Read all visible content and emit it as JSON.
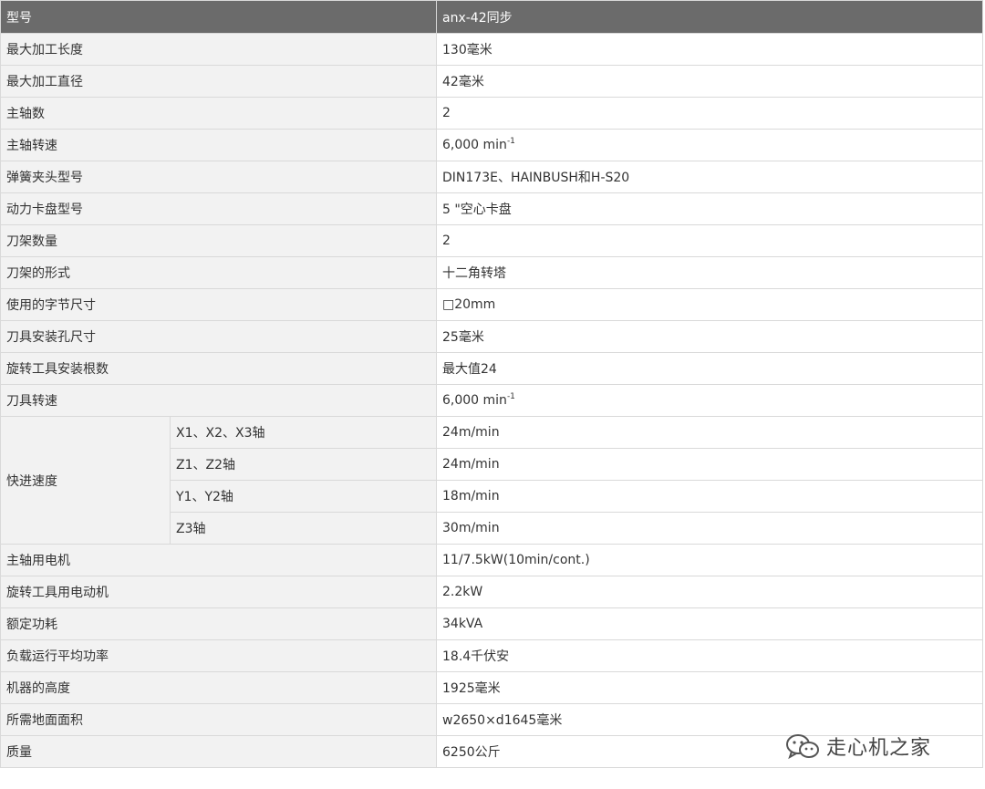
{
  "header": {
    "label": "型号",
    "model": "anx-42同步"
  },
  "rows_top": [
    {
      "label": "最大加工长度",
      "value": "130毫米"
    },
    {
      "label": "最大加工直径",
      "value": "42毫米"
    },
    {
      "label": "主轴数",
      "value": "2"
    },
    {
      "label": "主轴转速",
      "value": "6,000 min",
      "sup": "-1"
    },
    {
      "label": "弹簧夹头型号",
      "value": "DIN173E、HAINBUSH和H-S20"
    },
    {
      "label": "动力卡盘型号",
      "value": "5 \"空心卡盘"
    },
    {
      "label": "刀架数量",
      "value": "2"
    },
    {
      "label": "刀架的形式",
      "value": "十二角转塔"
    },
    {
      "label": "使用的字节尺寸",
      "value": "□20mm"
    },
    {
      "label": "刀具安装孔尺寸",
      "value": "25毫米"
    },
    {
      "label": "旋转工具安装根数",
      "value": "最大值24"
    },
    {
      "label": "刀具转速",
      "value": "6,000 min",
      "sup": "-1"
    }
  ],
  "rapid": {
    "label": "快进速度",
    "items": [
      {
        "axis": "X1、X2、X3轴",
        "value": "24m/min"
      },
      {
        "axis": "Z1、Z2轴",
        "value": "24m/min"
      },
      {
        "axis": "Y1、Y2轴",
        "value": "18m/min"
      },
      {
        "axis": "Z3轴",
        "value": "30m/min"
      }
    ]
  },
  "rows_bottom": [
    {
      "label": "主轴用电机",
      "value": "11/7.5kW(10min/cont.)"
    },
    {
      "label": "旋转工具用电动机",
      "value": "2.2kW"
    },
    {
      "label": "额定功耗",
      "value": "34kVA"
    },
    {
      "label": "负载运行平均功率",
      "value": "18.4千伏安"
    },
    {
      "label": "机器的高度",
      "value": "1925毫米"
    },
    {
      "label": "所需地面面积",
      "value": "w2650×d1645毫米"
    },
    {
      "label": "质量",
      "value": "6250公斤"
    }
  ],
  "watermark": {
    "text": "走心机之家",
    "icon": "wechat-icon"
  }
}
